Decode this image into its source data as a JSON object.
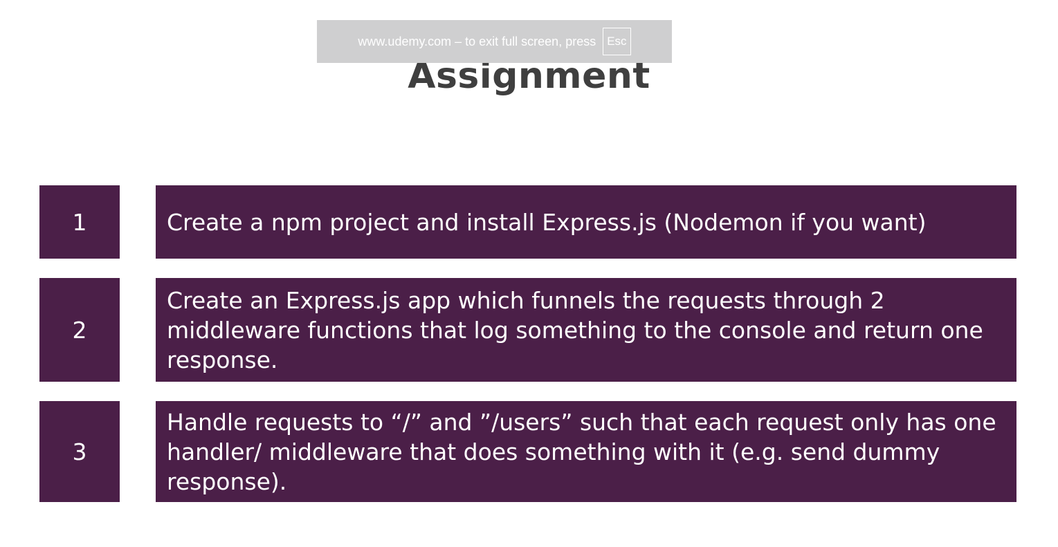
{
  "fullscreen_notice": {
    "message": "www.udemy.com – to exit full screen, press",
    "key": "Esc"
  },
  "slide": {
    "title": "Assignment",
    "items": [
      {
        "number": "1",
        "text": "Create a npm project and install Express.js (Nodemon if you want)"
      },
      {
        "number": "2",
        "text": "Create an Express.js app which funnels the requests through 2 middleware functions that log something to the console and return one response."
      },
      {
        "number": "3",
        "text": "Handle requests to “/” and ”/users” such that each request only has one handler/ middleware that does something with it (e.g. send dummy response)."
      }
    ]
  },
  "colors": {
    "box_background": "#4b1f48",
    "title_text": "#3f3f3f",
    "banner_background": "#cfcfd0"
  }
}
